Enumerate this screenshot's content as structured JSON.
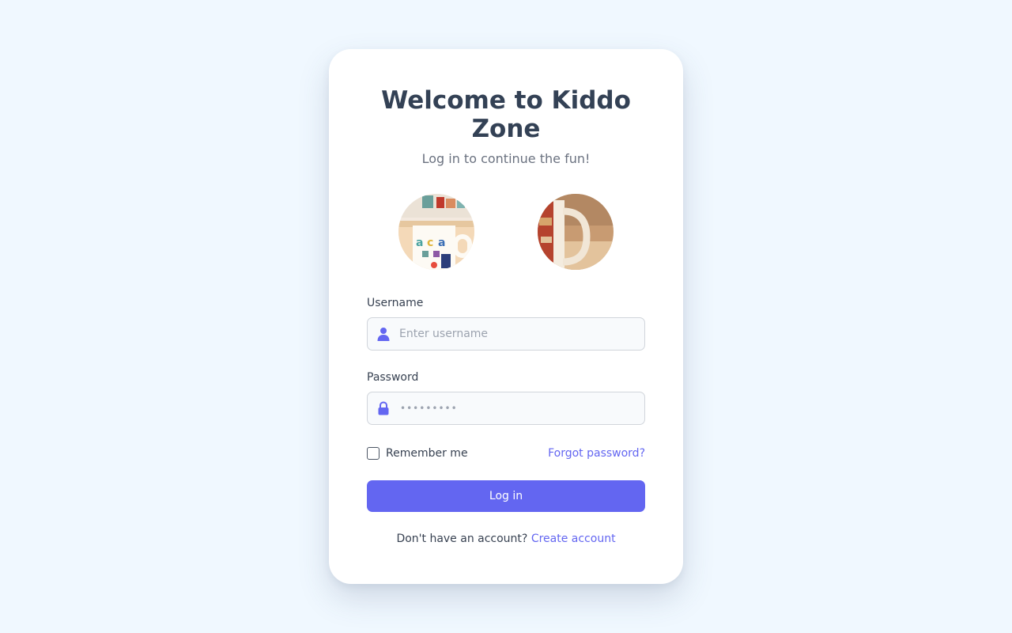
{
  "login": {
    "title": "Welcome to Kiddo Zone",
    "subtitle": "Log in to continue the fun!",
    "username_label": "Username",
    "username_placeholder": "Enter username",
    "password_label": "Password",
    "password_mask": "•••••••••",
    "remember_label": "Remember me",
    "forgot_link": "Forgot password?",
    "login_button": "Log in",
    "signup_prompt": "Don't have an account?",
    "signup_link": "Create account"
  },
  "icons": {
    "username": "user-icon",
    "password": "lock-icon"
  },
  "colors": {
    "background": "#f0f8ff",
    "accent": "#6366f1",
    "title": "#334155",
    "muted": "#6b7280"
  }
}
